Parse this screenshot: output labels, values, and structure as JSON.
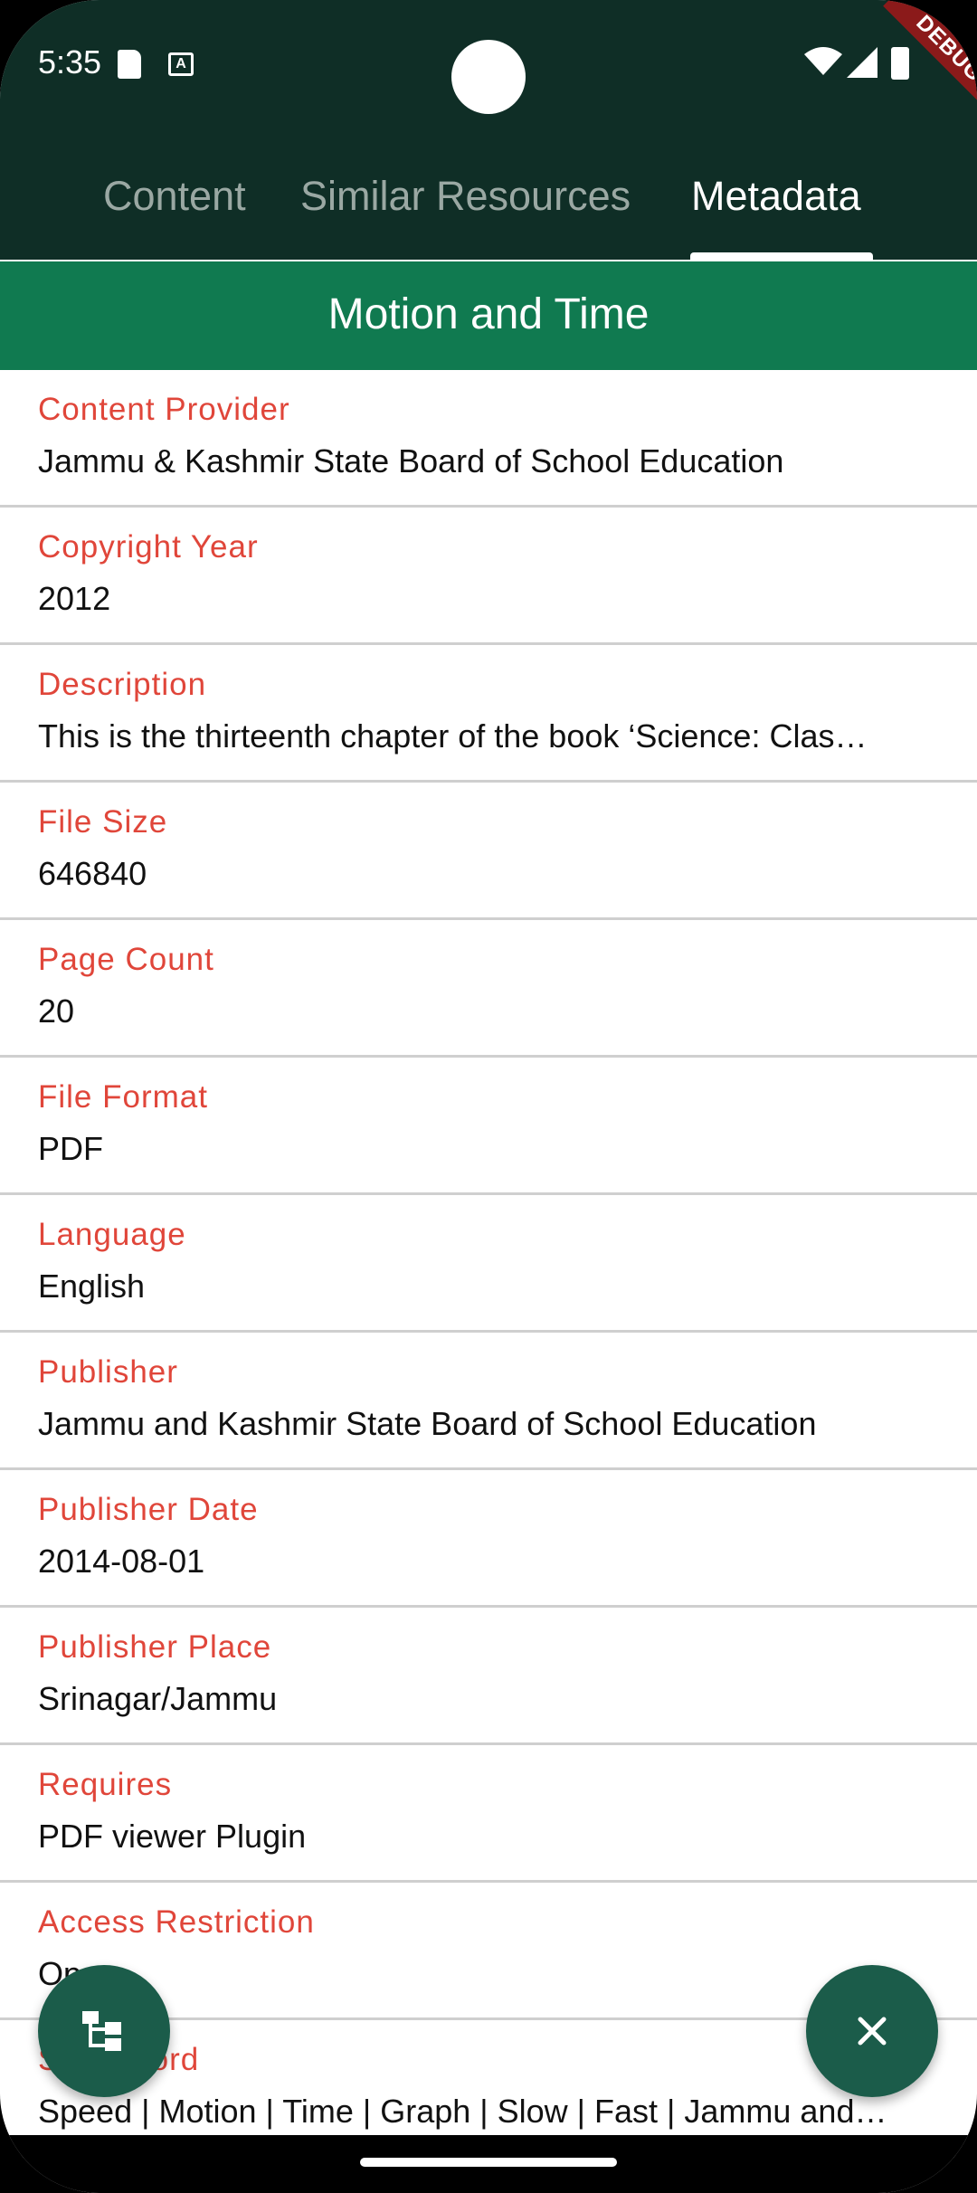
{
  "status_bar": {
    "time": "5:35",
    "sd_icon": "sd-card-icon",
    "a_icon_text": "A",
    "debug_label": "DEBUG"
  },
  "tabs": [
    {
      "label": "Content",
      "active": false
    },
    {
      "label": "Similar Resources",
      "active": false
    },
    {
      "label": "Metadata",
      "active": true
    }
  ],
  "title": "Motion and Time",
  "fields": [
    {
      "label": "Content Provider",
      "value": "Jammu & Kashmir State Board of School Education"
    },
    {
      "label": "Copyright Year",
      "value": "2012"
    },
    {
      "label": "Description",
      "value": "This is the thirteenth chapter of the book ‘Science: Clas…"
    },
    {
      "label": "File Size",
      "value": "646840"
    },
    {
      "label": "Page Count",
      "value": "20"
    },
    {
      "label": "File Format",
      "value": "PDF"
    },
    {
      "label": "Language",
      "value": "English"
    },
    {
      "label": "Publisher",
      "value": "Jammu and Kashmir State Board of School Education"
    },
    {
      "label": "Publisher Date",
      "value": "2014-08-01"
    },
    {
      "label": "Publisher Place",
      "value": "Srinagar/Jammu"
    },
    {
      "label": "Requires",
      "value": "PDF viewer Plugin"
    },
    {
      "label": "Access Restriction",
      "value": "Op"
    },
    {
      "label": "S   Keyword",
      "value": "Speed | Motion | Time | Graph | Slow | Fast | Jammu and…"
    }
  ],
  "icons": {
    "tree": "hierarchy-icon",
    "close": "close-icon"
  },
  "colors": {
    "header": "#0f2e26",
    "title_bar": "#107a50",
    "label": "#e0463a",
    "fab": "#1b5c4a"
  }
}
